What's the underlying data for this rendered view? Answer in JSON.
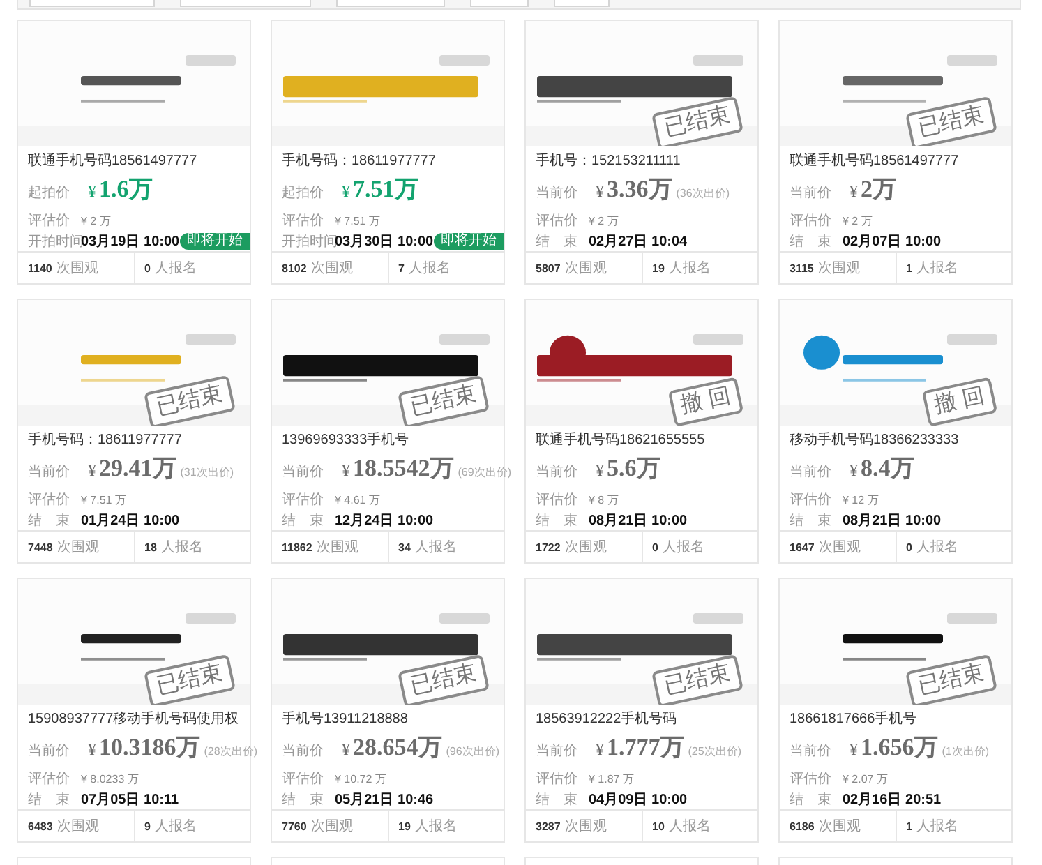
{
  "cards": [
    {
      "kind": "upcoming",
      "title": "联通手机号码18561497777",
      "price_label": "起拍价",
      "currency": "¥",
      "amount": "1.6万",
      "estimate_label": "评估价",
      "estimate": "¥ 2 万",
      "time_label": "开拍时间",
      "time": "03月19日 10:00",
      "badge": "即将开始",
      "views": "1140",
      "views_label": "次围观",
      "signups": "0",
      "signups_label": "人报名"
    },
    {
      "kind": "upcoming",
      "title": "手机号码：18611977777",
      "price_label": "起拍价",
      "currency": "¥",
      "amount": "7.51万",
      "estimate_label": "评估价",
      "estimate": "¥ 7.51 万",
      "time_label": "开拍时间",
      "time": "03月30日 10:00",
      "badge": "即将开始",
      "views": "8102",
      "views_label": "次围观",
      "signups": "7",
      "signups_label": "人报名"
    },
    {
      "kind": "ended",
      "stamp": "已结束",
      "title": "手机号：152153211111",
      "price_label": "当前价",
      "currency": "¥",
      "amount": "3.36万",
      "bids": "(36次出价)",
      "estimate_label": "评估价",
      "estimate": "¥ 2 万",
      "time_label": "结　束",
      "time": "02月27日 10:04",
      "views": "5807",
      "views_label": "次围观",
      "signups": "19",
      "signups_label": "人报名"
    },
    {
      "kind": "ended",
      "stamp": "已结束",
      "title": "联通手机号码18561497777",
      "price_label": "当前价",
      "currency": "¥",
      "amount": "2万",
      "estimate_label": "评估价",
      "estimate": "¥ 2 万",
      "time_label": "结　束",
      "time": "02月07日 10:00",
      "views": "3115",
      "views_label": "次围观",
      "signups": "1",
      "signups_label": "人报名"
    },
    {
      "kind": "ended",
      "stamp": "已结束",
      "title": "手机号码：18611977777",
      "price_label": "当前价",
      "currency": "¥",
      "amount": "29.41万",
      "bids": "(31次出价)",
      "estimate_label": "评估价",
      "estimate": "¥ 7.51 万",
      "time_label": "结　束",
      "time": "01月24日 10:00",
      "views": "7448",
      "views_label": "次围观",
      "signups": "18",
      "signups_label": "人报名"
    },
    {
      "kind": "ended",
      "stamp": "已结束",
      "title": "13969693333手机号",
      "price_label": "当前价",
      "currency": "¥",
      "amount": "18.5542万",
      "bids": "(69次出价)",
      "estimate_label": "评估价",
      "estimate": "¥ 4.61 万",
      "time_label": "结　束",
      "time": "12月24日 10:00",
      "views": "11862",
      "views_label": "次围观",
      "signups": "34",
      "signups_label": "人报名"
    },
    {
      "kind": "ended",
      "stamp": "撤 回",
      "title": "联通手机号码18621655555",
      "price_label": "当前价",
      "currency": "¥",
      "amount": "5.6万",
      "estimate_label": "评估价",
      "estimate": "¥ 8 万",
      "time_label": "结　束",
      "time": "08月21日 10:00",
      "views": "1722",
      "views_label": "次围观",
      "signups": "0",
      "signups_label": "人报名"
    },
    {
      "kind": "ended",
      "stamp": "撤 回",
      "title": "移动手机号码18366233333",
      "price_label": "当前价",
      "currency": "¥",
      "amount": "8.4万",
      "estimate_label": "评估价",
      "estimate": "¥ 12 万",
      "time_label": "结　束",
      "time": "08月21日 10:00",
      "views": "1647",
      "views_label": "次围观",
      "signups": "0",
      "signups_label": "人报名"
    },
    {
      "kind": "ended",
      "stamp": "已结束",
      "title": "15908937777移动手机号码使用权",
      "price_label": "当前价",
      "currency": "¥",
      "amount": "10.3186万",
      "bids": "(28次出价)",
      "estimate_label": "评估价",
      "estimate": "¥ 8.0233 万",
      "time_label": "结　束",
      "time": "07月05日 10:11",
      "views": "6483",
      "views_label": "次围观",
      "signups": "9",
      "signups_label": "人报名"
    },
    {
      "kind": "ended",
      "stamp": "已结束",
      "title": "手机号13911218888",
      "price_label": "当前价",
      "currency": "¥",
      "amount": "28.654万",
      "bids": "(96次出价)",
      "estimate_label": "评估价",
      "estimate": "¥ 10.72 万",
      "time_label": "结　束",
      "time": "05月21日 10:46",
      "views": "7760",
      "views_label": "次围观",
      "signups": "19",
      "signups_label": "人报名"
    },
    {
      "kind": "ended",
      "stamp": "已结束",
      "title": "18563912222手机号码",
      "price_label": "当前价",
      "currency": "¥",
      "amount": "1.777万",
      "bids": "(25次出价)",
      "estimate_label": "评估价",
      "estimate": "¥ 1.87 万",
      "time_label": "结　束",
      "time": "04月09日 10:00",
      "views": "3287",
      "views_label": "次围观",
      "signups": "10",
      "signups_label": "人报名"
    },
    {
      "kind": "ended",
      "stamp": "已结束",
      "title": "18661817666手机号",
      "price_label": "当前价",
      "currency": "¥",
      "amount": "1.656万",
      "bids": "(1次出价)",
      "estimate_label": "评估价",
      "estimate": "¥ 2.07 万",
      "time_label": "结　束",
      "time": "02月16日 20:51",
      "views": "6186",
      "views_label": "次围观",
      "signups": "1",
      "signups_label": "人报名"
    }
  ]
}
